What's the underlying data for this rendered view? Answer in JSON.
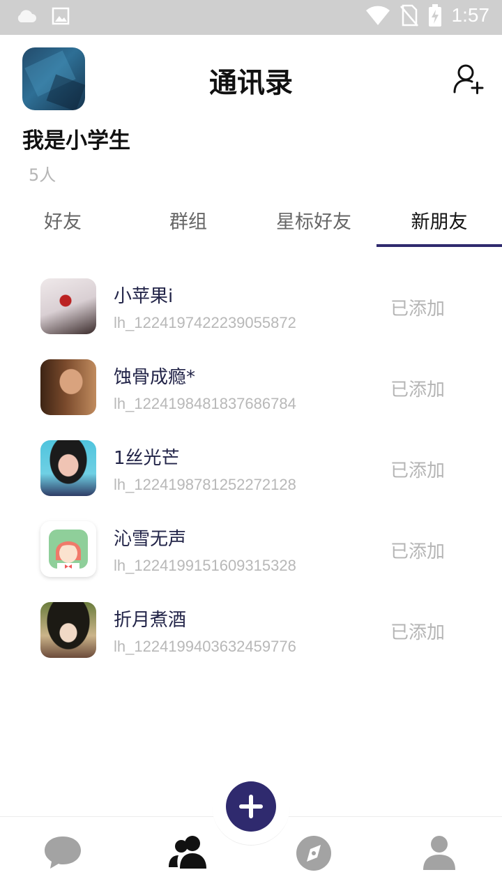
{
  "status_bar": {
    "time": "1:57",
    "icons": [
      "cloud-icon",
      "image-icon",
      "wifi-icon",
      "no-sim-icon",
      "battery-charging-icon"
    ]
  },
  "header": {
    "title": "通讯录",
    "username": "我是小学生",
    "member_count": "5人",
    "add_friend_icon": "add-user-icon"
  },
  "tabs": [
    {
      "label": "好友",
      "active": false
    },
    {
      "label": "群组",
      "active": false
    },
    {
      "label": "星标好友",
      "active": false
    },
    {
      "label": "新朋友",
      "active": true
    }
  ],
  "friends": [
    {
      "name": "小苹果i",
      "id": "lh_1224197422239055872",
      "status": "已添加"
    },
    {
      "name": "蚀骨成瘾*",
      "id": "lh_1224198481837686784",
      "status": "已添加"
    },
    {
      "name": "1丝光芒",
      "id": "lh_1224198781252272128",
      "status": "已添加"
    },
    {
      "name": "沁雪无声",
      "id": "lh_1224199151609315328",
      "status": "已添加"
    },
    {
      "name": "折月煮酒",
      "id": "lh_1224199403632459776",
      "status": "已添加"
    }
  ],
  "bottom_nav": {
    "items": [
      "chat-bubble-icon",
      "contacts-icon",
      "compass-icon",
      "profile-icon"
    ],
    "active": "contacts-icon",
    "fab": "plus-icon"
  },
  "colors": {
    "accent": "#2f2a6e",
    "inactive_icon": "#a3a3a3",
    "muted_text": "#b5b5b5"
  }
}
